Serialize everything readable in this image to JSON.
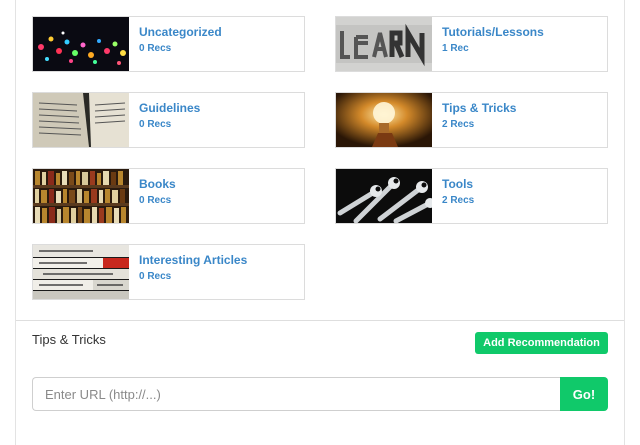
{
  "categories": [
    {
      "title": "Uncategorized",
      "count": "0 Recs",
      "thumb": "bokeh-lights-thumbnail"
    },
    {
      "title": "Tutorials/Lessons",
      "count": "1 Rec",
      "thumb": "learn-letters-thumbnail"
    },
    {
      "title": "Guidelines",
      "count": "0 Recs",
      "thumb": "open-book-thumbnail"
    },
    {
      "title": "Tips & Tricks",
      "count": "2 Recs",
      "thumb": "lightbulb-thumbnail"
    },
    {
      "title": "Books",
      "count": "0 Recs",
      "thumb": "bookshelf-thumbnail"
    },
    {
      "title": "Tools",
      "count": "2 Recs",
      "thumb": "wrenches-thumbnail"
    },
    {
      "title": "Interesting Articles",
      "count": "0 Recs",
      "thumb": "newspapers-thumbnail"
    }
  ],
  "section": {
    "title": "Tips & Tricks",
    "add_label": "Add Recommendation"
  },
  "url_form": {
    "placeholder": "Enter URL (http://...)",
    "go_label": "Go!"
  },
  "colors": {
    "accent_green": "#10c96a",
    "link_blue": "#3a87c8"
  }
}
